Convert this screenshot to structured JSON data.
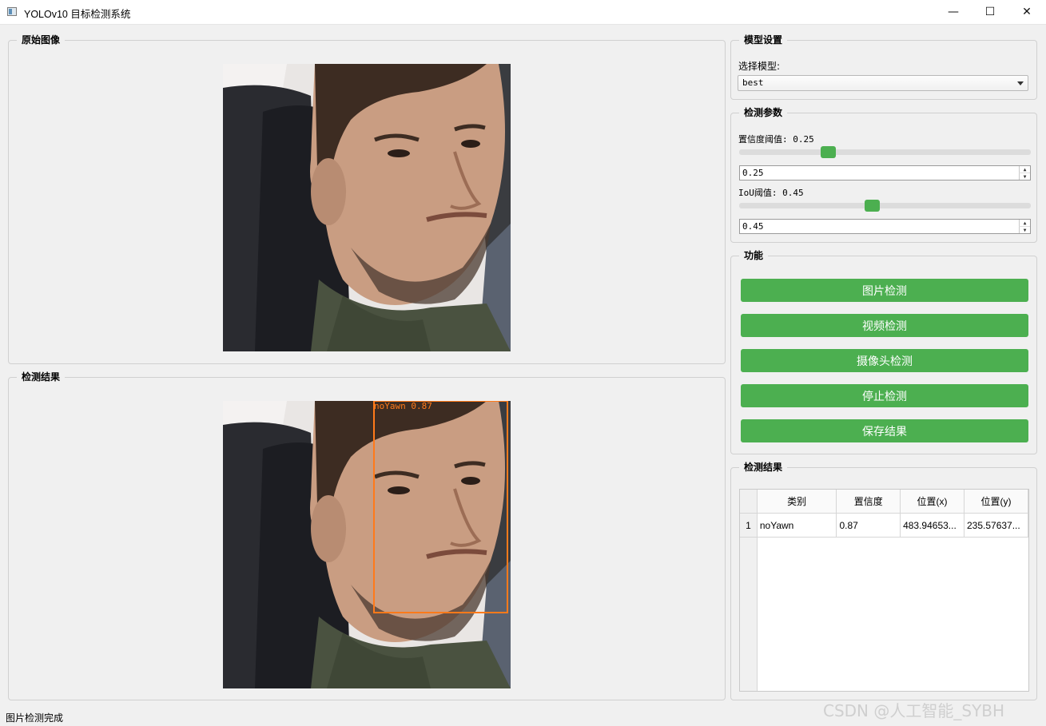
{
  "window": {
    "title": "YOLOv10 目标检测系统",
    "minimize": "—",
    "maximize": "☐",
    "close": "✕"
  },
  "original_panel": {
    "title": "原始图像"
  },
  "result_panel": {
    "title": "检测结果",
    "box_label": "noYawn 0.87",
    "box_color": "#ff7a1a"
  },
  "model_settings": {
    "title": "模型设置",
    "select_label": "选择模型:",
    "selected_model": "best"
  },
  "detection_params": {
    "title": "检测参数",
    "conf_label": "置信度阈值: 0.25",
    "conf_value": "0.25",
    "conf_fraction": 0.25,
    "iou_label": "IoU阈值: 0.45",
    "iou_value": "0.45",
    "iou_fraction": 0.45
  },
  "functions": {
    "title": "功能",
    "buttons": [
      "图片检测",
      "视频检测",
      "摄像头检测",
      "停止检测",
      "保存结果"
    ]
  },
  "results_table": {
    "title": "检测结果",
    "headers": [
      "类别",
      "置信度",
      "位置(x)",
      "位置(y)"
    ],
    "rows": [
      {
        "index": "1",
        "class": "noYawn",
        "confidence": "0.87",
        "x": "483.94653...",
        "y": "235.57637..."
      }
    ]
  },
  "status_bar": {
    "text": "图片检测完成"
  },
  "watermark": "CSDN @人工智能_SYBH",
  "colors": {
    "accent": "#4caf50",
    "box": "#ff7a1a"
  }
}
